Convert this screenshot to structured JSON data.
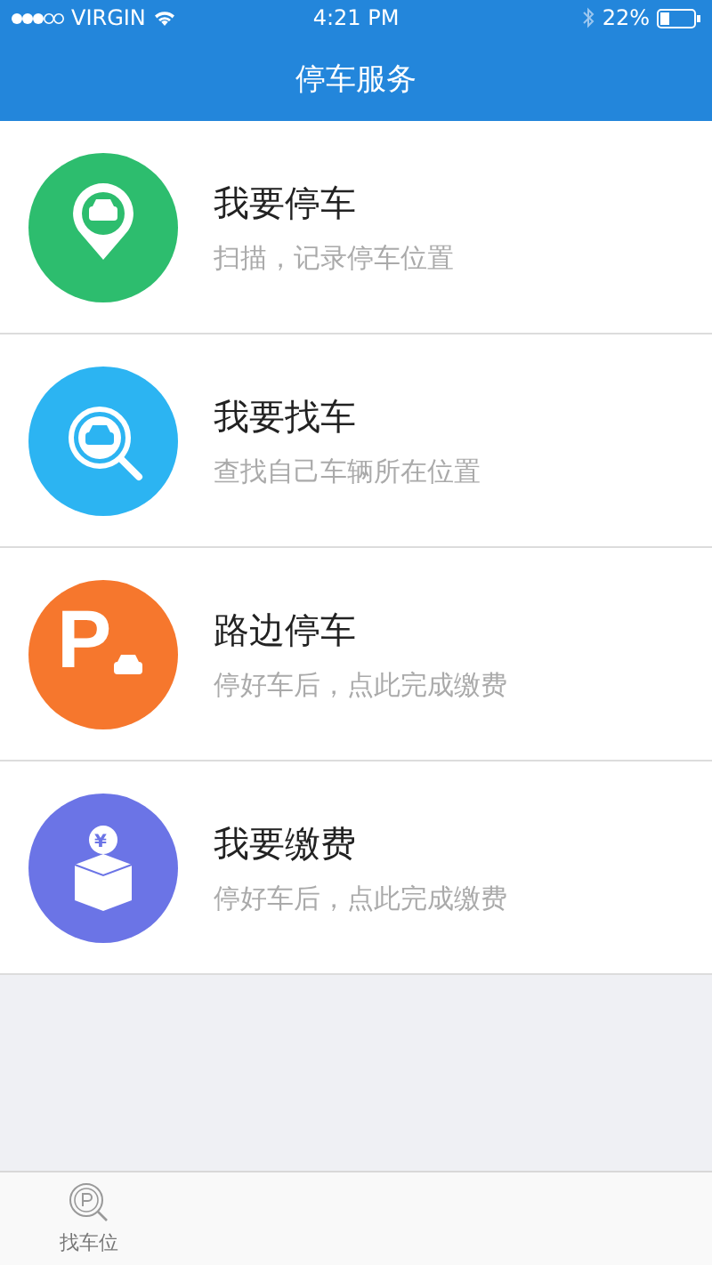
{
  "status_bar": {
    "carrier": "VIRGIN",
    "time": "4:21 PM",
    "battery": "22%"
  },
  "nav_bar": {
    "title": "停车服务"
  },
  "services": [
    {
      "kind": "pin",
      "color": "#2dbd6e",
      "title": "我要停车",
      "subtitle": "扫描，记录停车位置"
    },
    {
      "kind": "search",
      "color": "#2cb4f2",
      "title": "我要找车",
      "subtitle": "查找自己车辆所在位置"
    },
    {
      "kind": "parking",
      "color": "#f6772d",
      "icon_text": "P",
      "title": "路边停车",
      "subtitle": "停好车后，点此完成缴费"
    },
    {
      "kind": "payment",
      "color": "#6b74e6",
      "icon_text": "¥",
      "title": "我要缴费",
      "subtitle": "停好车后，点此完成缴费"
    }
  ],
  "tab_bar": {
    "items": [
      {
        "label": "找车位"
      }
    ]
  }
}
